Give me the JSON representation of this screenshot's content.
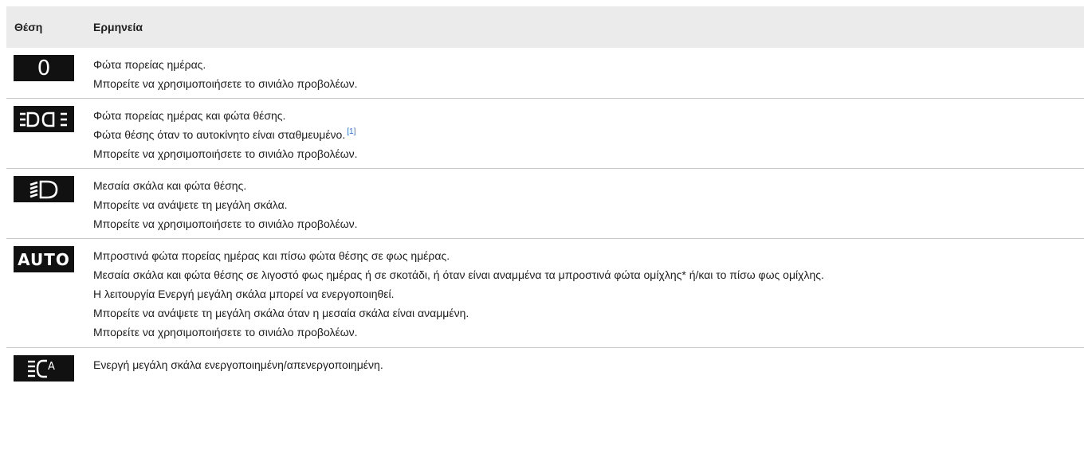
{
  "table": {
    "headers": [
      "Θέση",
      "Ερμηνεία"
    ],
    "rows": [
      {
        "icon": "zero-position-icon",
        "icon_text": "0",
        "lines": [
          "Φώτα πορείας ημέρας.",
          "Μπορείτε να χρησιμοποιήσετε το σινιάλο προβολέων."
        ]
      },
      {
        "icon": "position-lights-icon",
        "lines": [
          "Φώτα πορείας ημέρας και φώτα θέσης.",
          "Φώτα θέσης όταν το αυτοκίνητο είναι σταθμευμένο.",
          "Μπορείτε να χρησιμοποιήσετε το σινιάλο προβολέων."
        ],
        "footnote_ref": "[1]"
      },
      {
        "icon": "low-beam-icon",
        "lines": [
          "Μεσαία σκάλα και φώτα θέσης.",
          "Μπορείτε να ανάψετε τη μεγάλη σκάλα.",
          "Μπορείτε να χρησιμοποιήσετε το σινιάλο προβολέων."
        ]
      },
      {
        "icon": "auto-lights-icon",
        "icon_text": "AUTO",
        "lines": [
          "Μπροστινά φώτα πορείας ημέρας και πίσω φώτα θέσης σε φως ημέρας.",
          "Μεσαία σκάλα και φώτα θέσης σε λιγοστό φως ημέρας ή σε σκοτάδι, ή όταν είναι αναμμένα τα μπροστινά φώτα ομίχλης* ή/και το πίσω φως ομίχλης.",
          "Η λειτουργία Ενεργή μεγάλη σκάλα μπορεί να ενεργοποιηθεί.",
          "Μπορείτε να ανάψετε τη μεγάλη σκάλα όταν η μεσαία σκάλα είναι αναμμένη.",
          "Μπορείτε να χρησιμοποιήσετε το σινιάλο προβολέων."
        ]
      },
      {
        "icon": "active-high-beam-icon",
        "icon_text": "A",
        "lines": [
          "Ενεργή μεγάλη σκάλα ενεργοποιημένη/απενεργοποιημένη."
        ]
      }
    ]
  }
}
